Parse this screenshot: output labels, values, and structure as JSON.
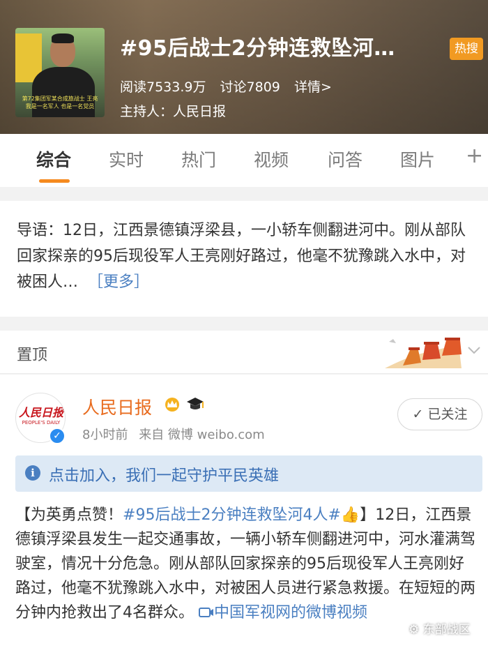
{
  "topic": {
    "title": "#95后战士2分钟连救坠河…",
    "hot_badge": "热搜",
    "reads": "阅读7533.9万",
    "discussions": "讨论7809",
    "details": "详情>",
    "host": "主持人：人民日报",
    "thumbnail_caption": "第72集团军某合成旅战士 王亮 我是一名军人 也是一名党员"
  },
  "tabs": [
    {
      "label": "综合",
      "active": true
    },
    {
      "label": "实时"
    },
    {
      "label": "热门"
    },
    {
      "label": "视频"
    },
    {
      "label": "问答"
    },
    {
      "label": "图片"
    }
  ],
  "intro": {
    "text": "导语：12日，江西景德镇浮梁县，一小轿车侧翻进河中。刚从部队回家探亲的95后现役军人王亮刚好路过，他毫不犹豫跳入水中，对被困人…",
    "more": "［更多］"
  },
  "pinned": {
    "label": "置顶"
  },
  "post": {
    "author": "人民日报",
    "avatar_logo": "人民日报",
    "avatar_logo_en": "PEOPLE'S DAILY",
    "time": "8小时前",
    "source": "来自 微博 weibo.com",
    "follow_label": "已关注",
    "banner": "点击加入，我们一起守护平民英雄",
    "text_prefix": "【为英勇点赞！",
    "hashtag": "#95后战士2分钟连救坠河4人#👍",
    "text_body": "】12日，江西景德镇浮梁县发生一起交通事故，一辆小轿车侧翻进河中，河水灌满驾驶室，情况十分危急。刚从部队回家探亲的95后现役军人王亮刚好路过，他毫不犹豫跳入水中，对被困人员进行紧急救援。在短短的两分钟内抢救出了4名群众。",
    "video_link": "中国军视网的微博视频"
  },
  "watermark": "东部战区",
  "colors": {
    "accent": "#f58a1f",
    "link": "#4a7fc1",
    "author": "#e86b1e",
    "hot": "#f19a22"
  }
}
